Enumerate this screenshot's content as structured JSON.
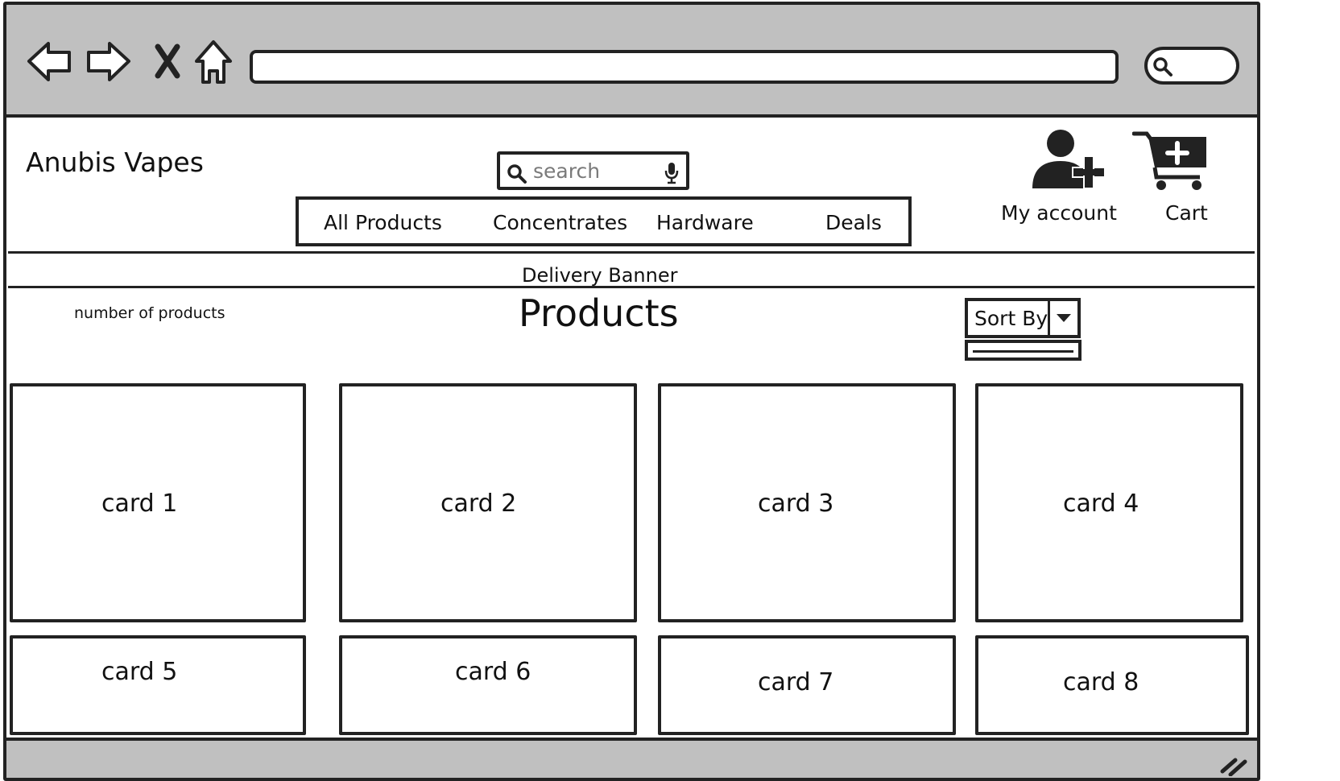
{
  "browser": {
    "back_icon": "back-arrow-icon",
    "forward_icon": "forward-arrow-icon",
    "close_icon": "close-x-icon",
    "home_icon": "home-icon",
    "url": "",
    "search_icon": "search-icon"
  },
  "header": {
    "brand": "Anubis Vapes",
    "search_placeholder": "search",
    "account_label": "My account",
    "cart_label": "Cart"
  },
  "nav": {
    "items": [
      "All Products",
      "Concentrates",
      "Hardware",
      "Deals"
    ]
  },
  "banner": "Delivery Banner",
  "products": {
    "count_label": "number of products",
    "title": "Products",
    "sort_label": "Sort By"
  },
  "cards": [
    "card 1",
    "card 2",
    "card 3",
    "card 4",
    "card 5",
    "card 6",
    "card 7",
    "card 8"
  ]
}
